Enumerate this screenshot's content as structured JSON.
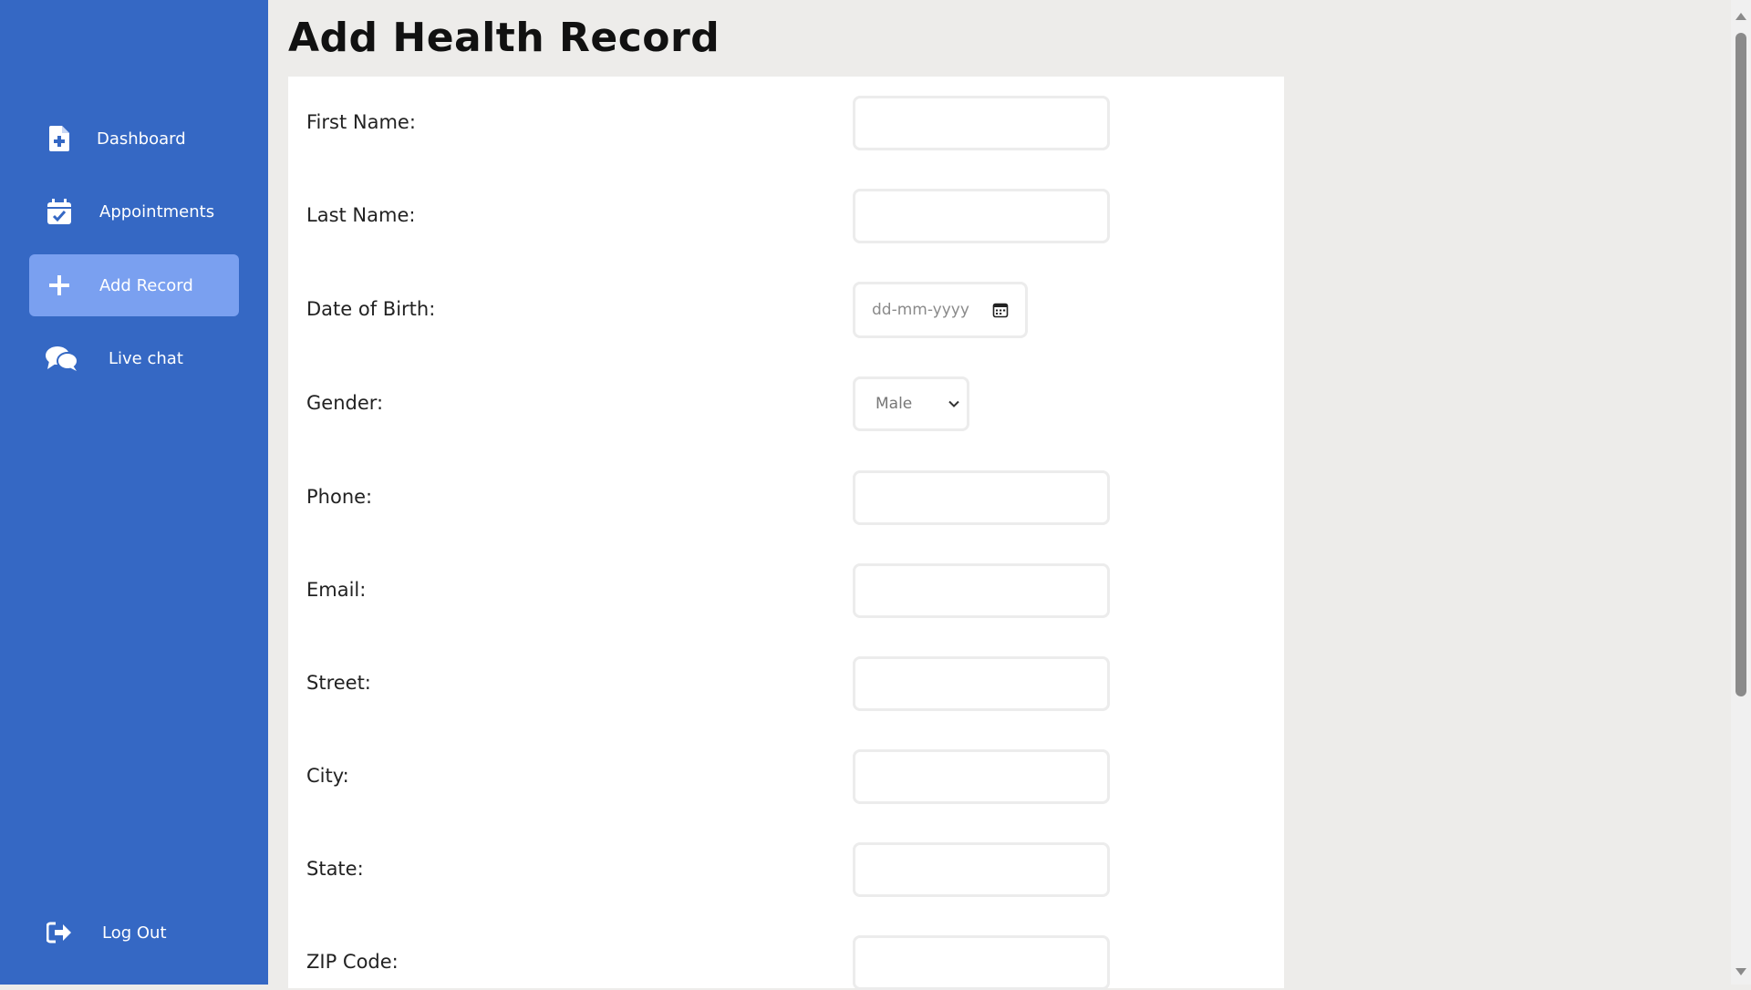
{
  "sidebar": {
    "items": [
      {
        "label": "Dashboard",
        "icon": "file-plus-icon"
      },
      {
        "label": "Appointments",
        "icon": "calendar-check-icon"
      },
      {
        "label": "Add Record",
        "icon": "plus-icon",
        "active": true
      },
      {
        "label": "Live chat",
        "icon": "chat-bubbles-icon"
      }
    ],
    "logout": {
      "label": "Log Out",
      "icon": "sign-out-icon"
    }
  },
  "main": {
    "title": "Add Health Record",
    "form": {
      "first_name": {
        "label": "First Name:",
        "value": ""
      },
      "last_name": {
        "label": "Last Name:",
        "value": ""
      },
      "dob": {
        "label": "Date of Birth:",
        "placeholder": "dd-mm-yyyy"
      },
      "gender": {
        "label": "Gender:",
        "selected": "Male"
      },
      "phone": {
        "label": "Phone:",
        "value": ""
      },
      "email": {
        "label": "Email:",
        "value": ""
      },
      "street": {
        "label": "Street:",
        "value": ""
      },
      "city": {
        "label": "City:",
        "value": ""
      },
      "state": {
        "label": "State:",
        "value": ""
      },
      "zip": {
        "label": "ZIP Code:",
        "value": ""
      }
    }
  },
  "colors": {
    "sidebar_bg": "#3568c4",
    "active_item_bg": "#7aa0f0",
    "page_bg": "#edecea",
    "card_bg": "#ffffff"
  }
}
